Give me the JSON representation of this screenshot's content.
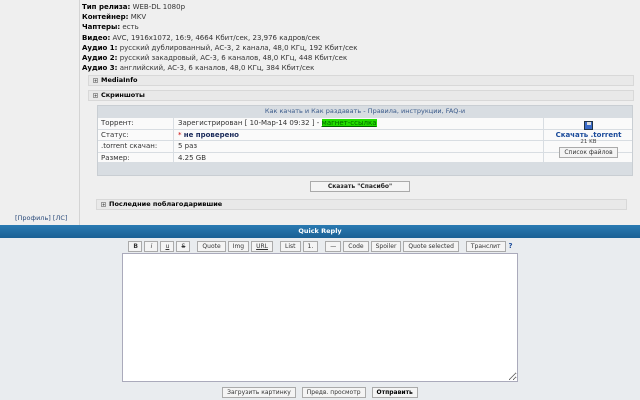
{
  "sidebar": {
    "profile": "[Профиль]",
    "pm": "[ЛС]"
  },
  "release": [
    {
      "label": "Тип релиза:",
      "value": "WEB-DL 1080p"
    },
    {
      "label": "Контейнер:",
      "value": "MKV"
    },
    {
      "label": "Чаптеры:",
      "value": "есть"
    },
    {
      "label": "Видео:",
      "value": "AVC, 1916x1072, 16:9, 4664 Кбит/сек, 23,976 кадров/сек"
    },
    {
      "label": "Аудио 1:",
      "value": "русский дублированный, AC-3, 2 канала, 48,0 КГц, 192 Кбит/сек"
    },
    {
      "label": "Аудио 2:",
      "value": "русский закадровый, AC-3, 6 каналов, 48,0 КГц, 448 Кбит/сек"
    },
    {
      "label": "Аудио 3:",
      "value": "английский, AC-3, 6 каналов, 48,0 КГц, 384 Кбит/сек"
    }
  ],
  "spoilers": {
    "mediainfo": "MediaInfo",
    "screens": "Скриншоты",
    "thanks": "Последние поблагодарившие"
  },
  "torrent": {
    "header": "Как качать и Как раздавать  -  Правила, инструкции, FAQ-и",
    "torrent_label": "Торрент:",
    "torrent_value": "Зарегистрирован  [ 10-Мар-14 09:32 ] - ",
    "magnet": "магнет-ссылка",
    "status_label": "Статус:",
    "status_mark": "*",
    "status_value": "не проверено",
    "downloads_label": ".torrent скачан:",
    "downloads_value": "5 раз",
    "size_label": "Размер:",
    "size_value": "4.25 GB",
    "download_link": "Скачать .torrent",
    "file_size": "21 KB",
    "file_list": "Список файлов",
    "magnet_bg": "#22dd00"
  },
  "thanks_button": "Сказать \"Спасибо\"",
  "quick_reply": {
    "title": "Quick Reply",
    "toolbar": [
      "B",
      "i",
      "u",
      "S",
      "Quote",
      "Img",
      "URL",
      "List",
      "1.",
      "—",
      "Code",
      "Spoiler",
      "Quote selected",
      "Транслит"
    ],
    "help": "?",
    "upload": "Загрузить картинку",
    "preview": "Предв. просмотр",
    "submit": "Отправить"
  }
}
